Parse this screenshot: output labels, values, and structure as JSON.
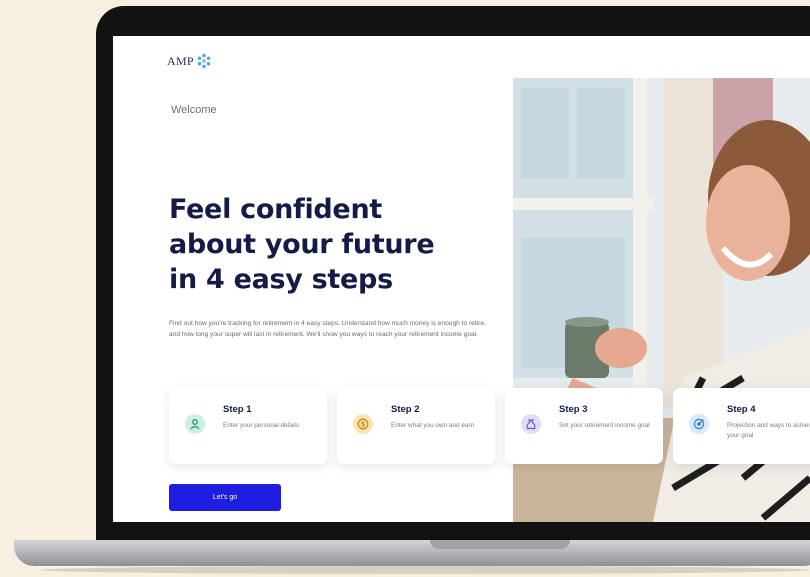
{
  "brand": {
    "logo_text": "AMP",
    "accent": "#1d1ee0",
    "navy": "#141b45"
  },
  "welcome": "Welcome",
  "headline": [
    "Feel confident",
    "about your future",
    "in 4 easy steps"
  ],
  "intro": "Find out how you're tracking for retirement in 4 easy steps. Understand how much money is enough to retire, and how long your super will last in retirement. We'll show you ways to reach your retirement income goal.",
  "steps": [
    {
      "title": "Step 1",
      "desc": "Enter your personal details",
      "icon": "user-icon",
      "icon_bg": "#cdeee3",
      "icon_color": "#1f9b78"
    },
    {
      "title": "Step 2",
      "desc": "Enter what you own and earn",
      "icon": "dollar-coin-icon",
      "icon_bg": "#fde3b5",
      "icon_color": "#c98a12"
    },
    {
      "title": "Step 3",
      "desc": "Set your retirement income goal",
      "icon": "money-bag-icon",
      "icon_bg": "#e2dcf6",
      "icon_color": "#6e58c7"
    },
    {
      "title": "Step 4",
      "desc": "Projection and ways to achieve your goal",
      "icon": "target-icon",
      "icon_bg": "#d5e9f8",
      "icon_color": "#2f7fc4"
    }
  ],
  "cta_label": "Let's go"
}
